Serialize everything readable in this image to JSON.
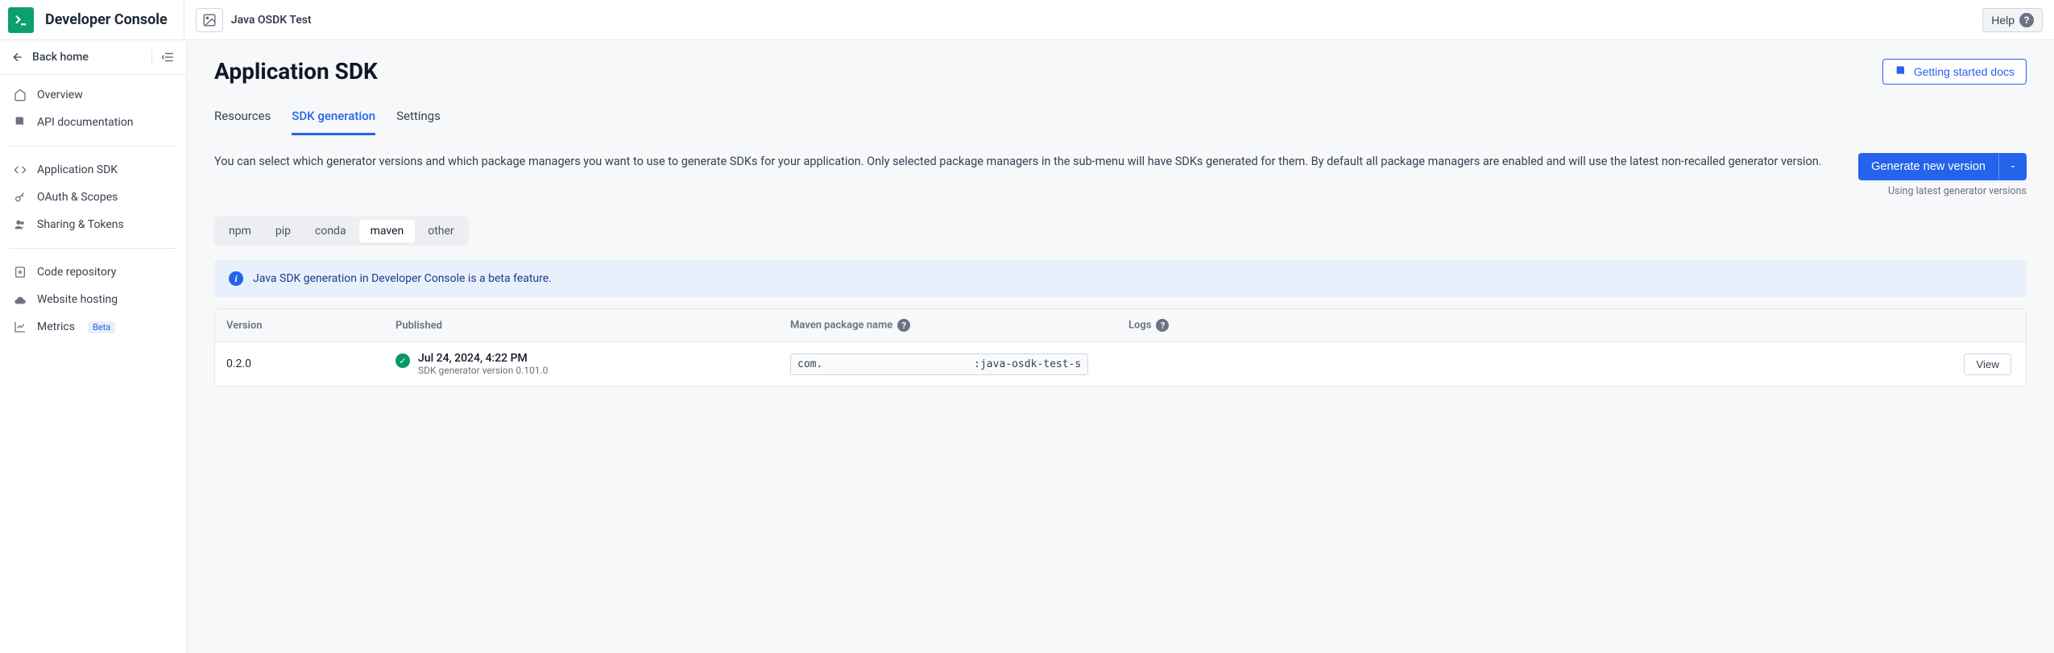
{
  "header": {
    "console_title": "Developer Console",
    "project_name": "Java OSDK Test",
    "help_label": "Help"
  },
  "sidebar": {
    "back_label": "Back home",
    "items": [
      {
        "label": "Overview",
        "icon": "dashboard-icon"
      },
      {
        "label": "API documentation",
        "icon": "book-icon"
      }
    ],
    "items2": [
      {
        "label": "Application SDK",
        "icon": "code-icon"
      },
      {
        "label": "OAuth & Scopes",
        "icon": "key-icon"
      },
      {
        "label": "Sharing & Tokens",
        "icon": "users-icon"
      }
    ],
    "items3": [
      {
        "label": "Code repository",
        "icon": "repo-icon"
      },
      {
        "label": "Website hosting",
        "icon": "cloud-icon"
      },
      {
        "label": "Metrics",
        "icon": "chart-icon",
        "badge": "Beta"
      }
    ]
  },
  "page": {
    "title": "Application SDK",
    "docs_btn": "Getting started docs",
    "tabs": {
      "resources": "Resources",
      "sdk_generation": "SDK generation",
      "settings": "Settings"
    },
    "description": "You can select which generator versions and which package managers you want to use to generate SDKs for your application. Only selected package managers in the sub-menu will have SDKs generated for them. By default all package managers are enabled and will use the latest non-recalled generator version.",
    "generate_btn": "Generate new version",
    "generate_sub": "Using latest generator versions",
    "pm_tabs": {
      "npm": "npm",
      "pip": "pip",
      "conda": "conda",
      "maven": "maven",
      "other": "other"
    },
    "info_banner": "Java SDK generation in Developer Console is a beta feature.",
    "table": {
      "headers": {
        "version": "Version",
        "published": "Published",
        "package": "Maven package name",
        "logs": "Logs"
      },
      "row": {
        "version": "0.2.0",
        "published_date": "Jul 24, 2024, 4:22 PM",
        "published_sub": "SDK generator version 0.101.0",
        "package_value": "com.                        :java-osdk-test-sdk",
        "view_label": "View"
      }
    }
  }
}
